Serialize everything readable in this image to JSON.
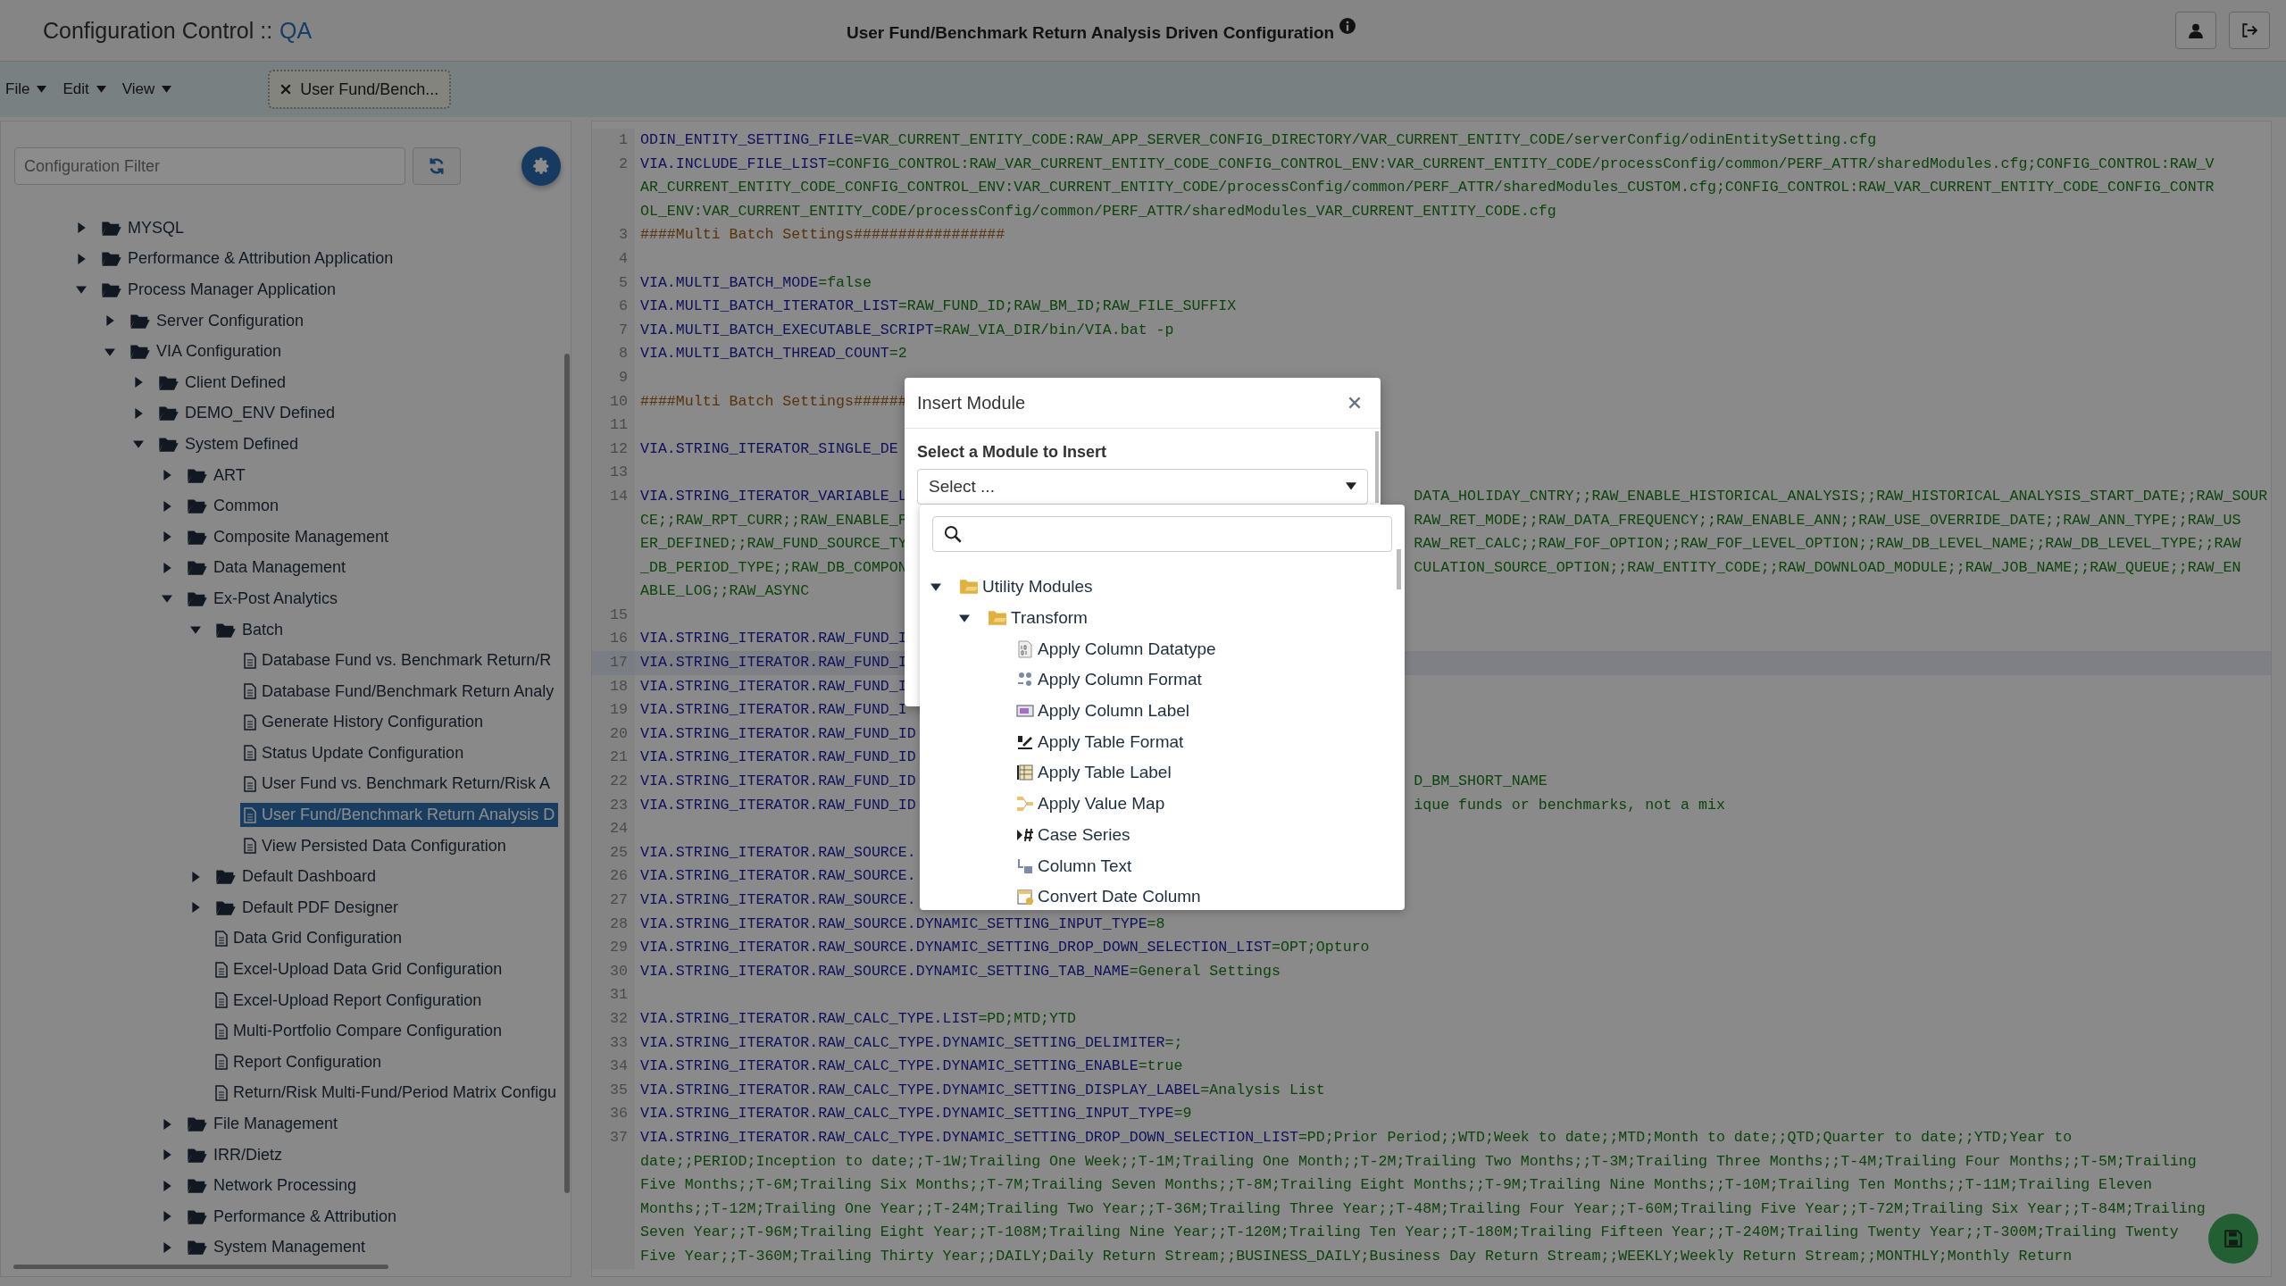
{
  "header": {
    "app_title": "Configuration Control ::",
    "environment": "QA",
    "page_title": "User Fund/Benchmark Return Analysis Driven Configuration"
  },
  "menus": [
    {
      "label": "File"
    },
    {
      "label": "Edit"
    },
    {
      "label": "View"
    }
  ],
  "tabs": [
    {
      "label": "User Fund/Bench..."
    }
  ],
  "sidebar": {
    "filter": {
      "placeholder": "Configuration Filter"
    },
    "tree": [
      {
        "label": "MYSQL",
        "kind": "folder",
        "expanded": false,
        "selected": false
      },
      {
        "label": "Performance & Attribution Application",
        "kind": "folder",
        "expanded": false,
        "selected": false
      },
      {
        "label": "Process Manager Application",
        "kind": "folder",
        "expanded": true,
        "selected": false,
        "children": [
          {
            "label": "Server Configuration",
            "kind": "folder",
            "expanded": false,
            "selected": false
          },
          {
            "label": "VIA Configuration",
            "kind": "folder",
            "expanded": true,
            "selected": false,
            "children": [
              {
                "label": "Client Defined",
                "kind": "folder",
                "expanded": false,
                "selected": false
              },
              {
                "label": "DEMO_ENV Defined",
                "kind": "folder",
                "expanded": false,
                "selected": false
              },
              {
                "label": "System Defined",
                "kind": "folder",
                "expanded": true,
                "selected": false,
                "children": [
                  {
                    "label": "ART",
                    "kind": "folder",
                    "expanded": false,
                    "selected": false
                  },
                  {
                    "label": "Common",
                    "kind": "folder",
                    "expanded": false,
                    "selected": false
                  },
                  {
                    "label": "Composite Management",
                    "kind": "folder",
                    "expanded": false,
                    "selected": false
                  },
                  {
                    "label": "Data Management",
                    "kind": "folder",
                    "expanded": false,
                    "selected": false
                  },
                  {
                    "label": "Ex-Post Analytics",
                    "kind": "folder",
                    "expanded": true,
                    "selected": false,
                    "children": [
                      {
                        "label": "Batch",
                        "kind": "folder",
                        "expanded": true,
                        "selected": false,
                        "children": [
                          {
                            "label": "Database Fund vs. Benchmark Return/R",
                            "kind": "file",
                            "selected": false
                          },
                          {
                            "label": "Database Fund/Benchmark Return Analy",
                            "kind": "file",
                            "selected": false
                          },
                          {
                            "label": "Generate History Configuration",
                            "kind": "file",
                            "selected": false
                          },
                          {
                            "label": "Status Update Configuration",
                            "kind": "file",
                            "selected": false
                          },
                          {
                            "label": "User Fund vs. Benchmark Return/Risk A",
                            "kind": "file",
                            "selected": false
                          },
                          {
                            "label": "User Fund/Benchmark Return Analysis D",
                            "kind": "file",
                            "selected": true
                          },
                          {
                            "label": "View Persisted Data Configuration",
                            "kind": "file",
                            "selected": false
                          }
                        ]
                      },
                      {
                        "label": "Default Dashboard",
                        "kind": "folder",
                        "expanded": false,
                        "selected": false
                      },
                      {
                        "label": "Default PDF Designer",
                        "kind": "folder",
                        "expanded": false,
                        "selected": false
                      },
                      {
                        "label": "Data Grid Configuration",
                        "kind": "file",
                        "selected": false
                      },
                      {
                        "label": "Excel-Upload Data Grid Configuration",
                        "kind": "file",
                        "selected": false
                      },
                      {
                        "label": "Excel-Upload Report Configuration",
                        "kind": "file",
                        "selected": false
                      },
                      {
                        "label": "Multi-Portfolio Compare Configuration",
                        "kind": "file",
                        "selected": false
                      },
                      {
                        "label": "Report Configuration",
                        "kind": "file",
                        "selected": false
                      },
                      {
                        "label": "Return/Risk Multi-Fund/Period Matrix Configu",
                        "kind": "file",
                        "selected": false
                      }
                    ]
                  },
                  {
                    "label": "File Management",
                    "kind": "folder",
                    "expanded": false,
                    "selected": false
                  },
                  {
                    "label": "IRR/Dietz",
                    "kind": "folder",
                    "expanded": false,
                    "selected": false
                  },
                  {
                    "label": "Network Processing",
                    "kind": "folder",
                    "expanded": false,
                    "selected": false
                  },
                  {
                    "label": "Performance & Attribution",
                    "kind": "folder",
                    "expanded": false,
                    "selected": false
                  },
                  {
                    "label": "System Management",
                    "kind": "folder",
                    "expanded": false,
                    "selected": false
                  }
                ]
              }
            ]
          }
        ]
      }
    ]
  },
  "editor": {
    "lines": [
      {
        "number": "1",
        "highlighted": false,
        "rows": [
          {
            "segments": [
              {
                "kind": "key",
                "text": "ODIN_ENTITY_SETTING_FILE"
              },
              {
                "kind": "value",
                "text": "=VAR_CURRENT_ENTITY_CODE:RAW_APP_SERVER_CONFIG_DIRECTORY/VAR_CURRENT_ENTITY_CODE/serverConfig/odinEntitySetting.cfg"
              }
            ]
          }
        ]
      },
      {
        "number": "2",
        "highlighted": false,
        "rows": [
          {
            "segments": [
              {
                "kind": "key",
                "text": "VIA.INCLUDE_FILE_LIST"
              },
              {
                "kind": "value",
                "text": "=CONFIG_CONTROL:RAW_VAR_CURRENT_ENTITY_CODE_CONFIG_CONTROL_ENV:VAR_CURRENT_ENTITY_CODE/processConfig/common/PERF_ATTR/sharedModules.cfg;CONFIG_CONTROL:RAW_V"
              }
            ]
          },
          {
            "segments": [
              {
                "kind": "value",
                "text": "AR_CURRENT_ENTITY_CODE_CONFIG_CONTROL_ENV:VAR_CURRENT_ENTITY_CODE/processConfig/common/PERF_ATTR/sharedModules_CUSTOM.cfg;CONFIG_CONTROL:RAW_VAR_CURRENT_ENTITY_CODE_CONFIG_CONTR"
              }
            ]
          },
          {
            "segments": [
              {
                "kind": "value",
                "text": "OL_ENV:VAR_CURRENT_ENTITY_CODE/processConfig/common/PERF_ATTR/sharedModules_VAR_CURRENT_ENTITY_CODE.cfg"
              }
            ]
          }
        ]
      },
      {
        "number": "3",
        "highlighted": false,
        "rows": [
          {
            "segments": [
              {
                "kind": "comment",
                "text": "####Multi Batch Settings#################"
              }
            ]
          }
        ]
      },
      {
        "number": "4",
        "highlighted": false,
        "rows": [
          {
            "segments": []
          }
        ]
      },
      {
        "number": "5",
        "highlighted": false,
        "rows": [
          {
            "segments": [
              {
                "kind": "key",
                "text": "VIA.MULTI_BATCH_MODE"
              },
              {
                "kind": "value",
                "text": "=false"
              }
            ]
          }
        ]
      },
      {
        "number": "6",
        "highlighted": false,
        "rows": [
          {
            "segments": [
              {
                "kind": "key",
                "text": "VIA.MULTI_BATCH_ITERATOR_LIST"
              },
              {
                "kind": "value",
                "text": "=RAW_FUND_ID;RAW_BM_ID;RAW_FILE_SUFFIX"
              }
            ]
          }
        ]
      },
      {
        "number": "7",
        "highlighted": false,
        "rows": [
          {
            "segments": [
              {
                "kind": "key",
                "text": "VIA.MULTI_BATCH_EXECUTABLE_SCRIPT"
              },
              {
                "kind": "value",
                "text": "=RAW_VIA_DIR/bin/VIA.bat -p"
              }
            ]
          }
        ]
      },
      {
        "number": "8",
        "highlighted": false,
        "rows": [
          {
            "segments": [
              {
                "kind": "key",
                "text": "VIA.MULTI_BATCH_THREAD_COUNT"
              },
              {
                "kind": "value",
                "text": "=2"
              }
            ]
          }
        ]
      },
      {
        "number": "9",
        "highlighted": false,
        "rows": [
          {
            "segments": []
          }
        ]
      },
      {
        "number": "10",
        "highlighted": false,
        "rows": [
          {
            "segments": [
              {
                "kind": "comment",
                "text": "####Multi Batch Settings######"
              }
            ]
          }
        ]
      },
      {
        "number": "11",
        "highlighted": false,
        "rows": [
          {
            "segments": []
          }
        ]
      },
      {
        "number": "12",
        "highlighted": false,
        "rows": [
          {
            "segments": [
              {
                "kind": "key",
                "text": "VIA.STRING_ITERATOR_SINGLE_DE"
              }
            ]
          }
        ]
      },
      {
        "number": "13",
        "highlighted": false,
        "rows": [
          {
            "segments": []
          }
        ]
      },
      {
        "number": "14",
        "highlighted": false,
        "rows": [
          {
            "segments": [
              {
                "kind": "key",
                "text": "VIA.STRING_ITERATOR_VARIABLE_L"
              }
            ],
            "after_dialog": [
              {
                "kind": "value",
                "text": "DATA_HOLIDAY_CNTRY;;RAW_ENABLE_HISTORICAL_ANALYSIS;;RAW_HISTORICAL_ANALYSIS_START_DATE;;RAW_SOUR"
              }
            ]
          },
          {
            "segments": [
              {
                "kind": "value",
                "text": "CE;;RAW_RPT_CURR;;RAW_ENABLE_F"
              }
            ],
            "after_dialog": [
              {
                "kind": "value",
                "text": "RAW_RET_MODE;;RAW_DATA_FREQUENCY;;RAW_ENABLE_ANN;;RAW_USE_OVERRIDE_DATE;;RAW_ANN_TYPE;;RAW_US"
              }
            ]
          },
          {
            "segments": [
              {
                "kind": "value",
                "text": "ER_DEFINED;;RAW_FUND_SOURCE_TY"
              }
            ],
            "after_dialog": [
              {
                "kind": "value",
                "text": "RAW_RET_CALC;;RAW_FOF_OPTION;;RAW_FOF_LEVEL_OPTION;;RAW_DB_LEVEL_NAME;;RAW_DB_LEVEL_TYPE;;RAW"
              }
            ]
          },
          {
            "segments": [
              {
                "kind": "value",
                "text": "_DB_PERIOD_TYPE;;RAW_DB_COMPON"
              }
            ],
            "after_dialog": [
              {
                "kind": "value",
                "text": "CULATION_SOURCE_OPTION;;RAW_ENTITY_CODE;;RAW_DOWNLOAD_MODULE;;RAW_JOB_NAME;;RAW_QUEUE;;RAW_EN"
              }
            ]
          },
          {
            "segments": [
              {
                "kind": "value",
                "text": "ABLE_LOG;;RAW_ASYNC"
              }
            ]
          }
        ]
      },
      {
        "number": "15",
        "highlighted": false,
        "rows": [
          {
            "segments": []
          }
        ]
      },
      {
        "number": "16",
        "highlighted": false,
        "rows": [
          {
            "segments": [
              {
                "kind": "key",
                "text": "VIA.STRING_ITERATOR.RAW_FUND_I"
              }
            ]
          }
        ]
      },
      {
        "number": "17",
        "highlighted": true,
        "rows": [
          {
            "segments": [
              {
                "kind": "key",
                "text": "VIA.STRING_ITERATOR.RAW_FUND_I"
              }
            ]
          }
        ]
      },
      {
        "number": "18",
        "highlighted": false,
        "rows": [
          {
            "segments": [
              {
                "kind": "key",
                "text": "VIA.STRING_ITERATOR.RAW_FUND_I"
              }
            ]
          }
        ]
      },
      {
        "number": "19",
        "highlighted": false,
        "rows": [
          {
            "segments": [
              {
                "kind": "key",
                "text": "VIA.STRING_ITERATOR.RAW_FUND_I"
              }
            ]
          }
        ]
      },
      {
        "number": "20",
        "highlighted": false,
        "rows": [
          {
            "segments": [
              {
                "kind": "key",
                "text": "VIA.STRING_ITERATOR.RAW_FUND_ID"
              }
            ]
          }
        ]
      },
      {
        "number": "21",
        "highlighted": false,
        "rows": [
          {
            "segments": [
              {
                "kind": "key",
                "text": "VIA.STRING_ITERATOR.RAW_FUND_ID"
              }
            ]
          }
        ]
      },
      {
        "number": "22",
        "highlighted": false,
        "rows": [
          {
            "segments": [
              {
                "kind": "key",
                "text": "VIA.STRING_ITERATOR.RAW_FUND_ID"
              }
            ],
            "after_dialog": [
              {
                "kind": "value",
                "text": "D_BM_SHORT_NAME"
              }
            ]
          }
        ]
      },
      {
        "number": "23",
        "highlighted": false,
        "rows": [
          {
            "segments": [
              {
                "kind": "key",
                "text": "VIA.STRING_ITERATOR.RAW_FUND_ID"
              }
            ],
            "after_dialog": [
              {
                "kind": "value",
                "text": "ique funds or benchmarks, not a mix"
              }
            ]
          }
        ]
      },
      {
        "number": "24",
        "highlighted": false,
        "rows": [
          {
            "segments": []
          }
        ]
      },
      {
        "number": "25",
        "highlighted": false,
        "rows": [
          {
            "segments": [
              {
                "kind": "key",
                "text": "VIA.STRING_ITERATOR.RAW_SOURCE."
              }
            ]
          }
        ]
      },
      {
        "number": "26",
        "highlighted": false,
        "rows": [
          {
            "segments": [
              {
                "kind": "key",
                "text": "VIA.STRING_ITERATOR.RAW_SOURCE."
              }
            ]
          }
        ]
      },
      {
        "number": "27",
        "highlighted": false,
        "rows": [
          {
            "segments": [
              {
                "kind": "key",
                "text": "VIA.STRING_ITERATOR.RAW_SOURCE."
              }
            ]
          }
        ]
      },
      {
        "number": "28",
        "highlighted": false,
        "rows": [
          {
            "segments": [
              {
                "kind": "key",
                "text": "VIA.STRING_ITERATOR.RAW_SOURCE.DYNAMIC_SETTING_INPUT_TYPE"
              },
              {
                "kind": "value",
                "text": "=8"
              }
            ]
          }
        ]
      },
      {
        "number": "29",
        "highlighted": false,
        "rows": [
          {
            "segments": [
              {
                "kind": "key",
                "text": "VIA.STRING_ITERATOR.RAW_SOURCE.DYNAMIC_SETTING_DROP_DOWN_SELECTION_LIST"
              },
              {
                "kind": "value",
                "text": "=OPT;Opturo"
              }
            ]
          }
        ]
      },
      {
        "number": "30",
        "highlighted": false,
        "rows": [
          {
            "segments": [
              {
                "kind": "key",
                "text": "VIA.STRING_ITERATOR.RAW_SOURCE.DYNAMIC_SETTING_TAB_NAME"
              },
              {
                "kind": "value",
                "text": "=General Settings"
              }
            ]
          }
        ]
      },
      {
        "number": "31",
        "highlighted": false,
        "rows": [
          {
            "segments": []
          }
        ]
      },
      {
        "number": "32",
        "highlighted": false,
        "rows": [
          {
            "segments": [
              {
                "kind": "key",
                "text": "VIA.STRING_ITERATOR.RAW_CALC_TYPE.LIST"
              },
              {
                "kind": "value",
                "text": "=PD;MTD;YTD"
              }
            ]
          }
        ]
      },
      {
        "number": "33",
        "highlighted": false,
        "rows": [
          {
            "segments": [
              {
                "kind": "key",
                "text": "VIA.STRING_ITERATOR.RAW_CALC_TYPE.DYNAMIC_SETTING_DELIMITER"
              },
              {
                "kind": "value",
                "text": "=;"
              }
            ]
          }
        ]
      },
      {
        "number": "34",
        "highlighted": false,
        "rows": [
          {
            "segments": [
              {
                "kind": "key",
                "text": "VIA.STRING_ITERATOR.RAW_CALC_TYPE.DYNAMIC_SETTING_ENABLE"
              },
              {
                "kind": "value",
                "text": "=true"
              }
            ]
          }
        ]
      },
      {
        "number": "35",
        "highlighted": false,
        "rows": [
          {
            "segments": [
              {
                "kind": "key",
                "text": "VIA.STRING_ITERATOR.RAW_CALC_TYPE.DYNAMIC_SETTING_DISPLAY_LABEL"
              },
              {
                "kind": "value",
                "text": "=Analysis List"
              }
            ]
          }
        ]
      },
      {
        "number": "36",
        "highlighted": false,
        "rows": [
          {
            "segments": [
              {
                "kind": "key",
                "text": "VIA.STRING_ITERATOR.RAW_CALC_TYPE.DYNAMIC_SETTING_INPUT_TYPE"
              },
              {
                "kind": "value",
                "text": "=9"
              }
            ]
          }
        ]
      },
      {
        "number": "37",
        "highlighted": false,
        "rows": [
          {
            "segments": [
              {
                "kind": "key",
                "text": "VIA.STRING_ITERATOR.RAW_CALC_TYPE.DYNAMIC_SETTING_DROP_DOWN_SELECTION_LIST"
              },
              {
                "kind": "value",
                "text": "=PD;Prior Period;;WTD;Week to date;;MTD;Month to date;;QTD;Quarter to date;;YTD;Year to"
              }
            ]
          },
          {
            "segments": [
              {
                "kind": "value",
                "text": "date;;PERIOD;Inception to date;;T-1W;Trailing One Week;;T-1M;Trailing One Month;;T-2M;Trailing Two Months;;T-3M;Trailing Three Months;;T-4M;Trailing Four Months;;T-5M;Trailing"
              }
            ]
          },
          {
            "segments": [
              {
                "kind": "value",
                "text": "Five Months;;T-6M;Trailing Six Months;;T-7M;Trailing Seven Months;;T-8M;Trailing Eight Months;;T-9M;Trailing Nine Months;;T-10M;Trailing Ten Months;;T-11M;Trailing Eleven"
              }
            ]
          },
          {
            "segments": [
              {
                "kind": "value",
                "text": "Months;;T-12M;Trailing One Year;;T-24M;Trailing Two Year;;T-36M;Trailing Three Year;;T-48M;Trailing Four Year;;T-60M;Trailing Five Year;;T-72M;Trailing Six Year;;T-84M;Trailing"
              }
            ]
          },
          {
            "segments": [
              {
                "kind": "value",
                "text": "Seven Year;;T-96M;Trailing Eight Year;;T-108M;Trailing Nine Year;;T-120M;Trailing Ten Year;;T-180M;Trailing Fifteen Year;;T-240M;Trailing Twenty Year;;T-300M;Trailing Twenty"
              }
            ]
          },
          {
            "segments": [
              {
                "kind": "value",
                "text": "Five Year;;T-360M;Trailing Thirty Year;;DAILY;Daily Return Stream;;BUSINESS_DAILY;Business Day Return Stream;;WEEKLY;Weekly Return Stream;;MONTHLY;Monthly Return"
              }
            ]
          }
        ]
      }
    ]
  },
  "dialog": {
    "title": "Insert Module",
    "field_label": "Select a Module to Insert",
    "select": {
      "placeholder": "Select ..."
    },
    "dropdown": {
      "tree": [
        {
          "label": "Utility Modules",
          "expanded": true,
          "selected": false,
          "children": [
            {
              "label": "Transform",
              "expanded": true,
              "selected": false,
              "children": [
                {
                  "label": "Apply Column Datatype",
                  "selected": false
                },
                {
                  "label": "Apply Column Format",
                  "selected": false
                },
                {
                  "label": "Apply Column Label",
                  "selected": false
                },
                {
                  "label": "Apply Table Format",
                  "selected": false
                },
                {
                  "label": "Apply Table Label",
                  "selected": false
                },
                {
                  "label": "Apply Value Map",
                  "selected": false
                },
                {
                  "label": "Case Series",
                  "selected": false
                },
                {
                  "label": "Column Text",
                  "selected": false
                },
                {
                  "label": "Convert Date Column",
                  "selected": false
                }
              ]
            }
          ]
        }
      ]
    }
  }
}
